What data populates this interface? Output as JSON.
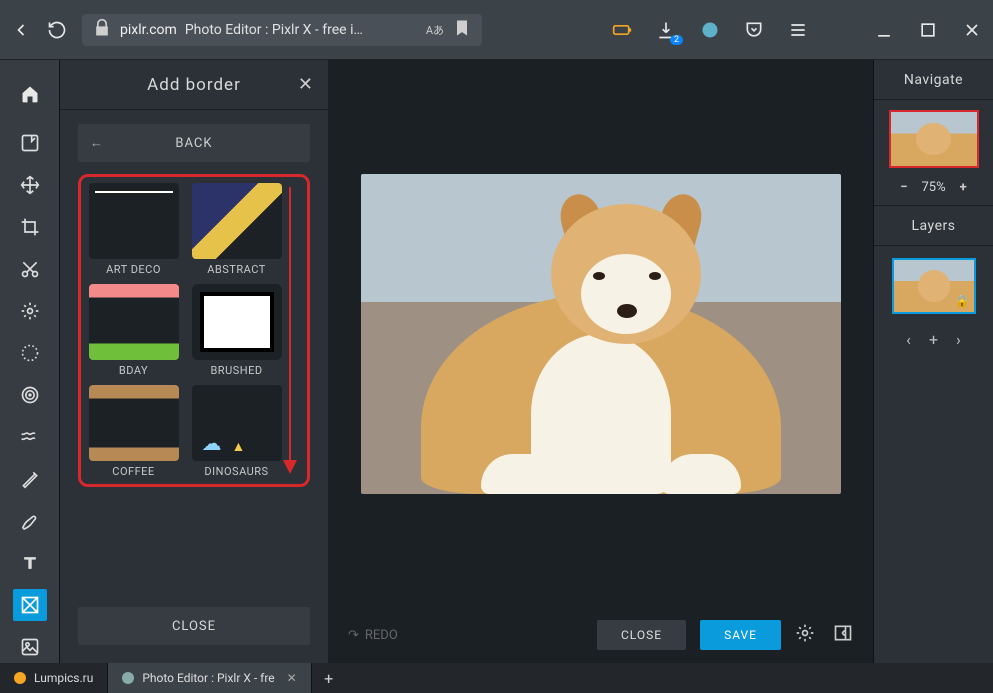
{
  "browser": {
    "host": "pixlr.com",
    "title": "Photo Editor : Pixlr X - free i…",
    "download_badge": "2"
  },
  "rail": {
    "tools": [
      "open",
      "arrange",
      "crop",
      "cut",
      "adjust",
      "filter",
      "effects",
      "liquify",
      "retouch",
      "draw",
      "text",
      "border",
      "element"
    ]
  },
  "panel": {
    "title": "Add border",
    "back": "BACK",
    "close": "CLOSE",
    "items": [
      {
        "label": "ART DECO"
      },
      {
        "label": "ABSTRACT"
      },
      {
        "label": "BDAY"
      },
      {
        "label": "BRUSHED"
      },
      {
        "label": "COFFEE"
      },
      {
        "label": "DINOSAURS"
      }
    ]
  },
  "canvas_bar": {
    "redo": "REDO",
    "close": "CLOSE",
    "save": "SAVE"
  },
  "right": {
    "navigate": "Navigate",
    "zoom": "75%",
    "layers": "Layers"
  },
  "tabs": [
    {
      "label": "Lumpics.ru"
    },
    {
      "label": "Photo Editor : Pixlr X - fre"
    }
  ]
}
